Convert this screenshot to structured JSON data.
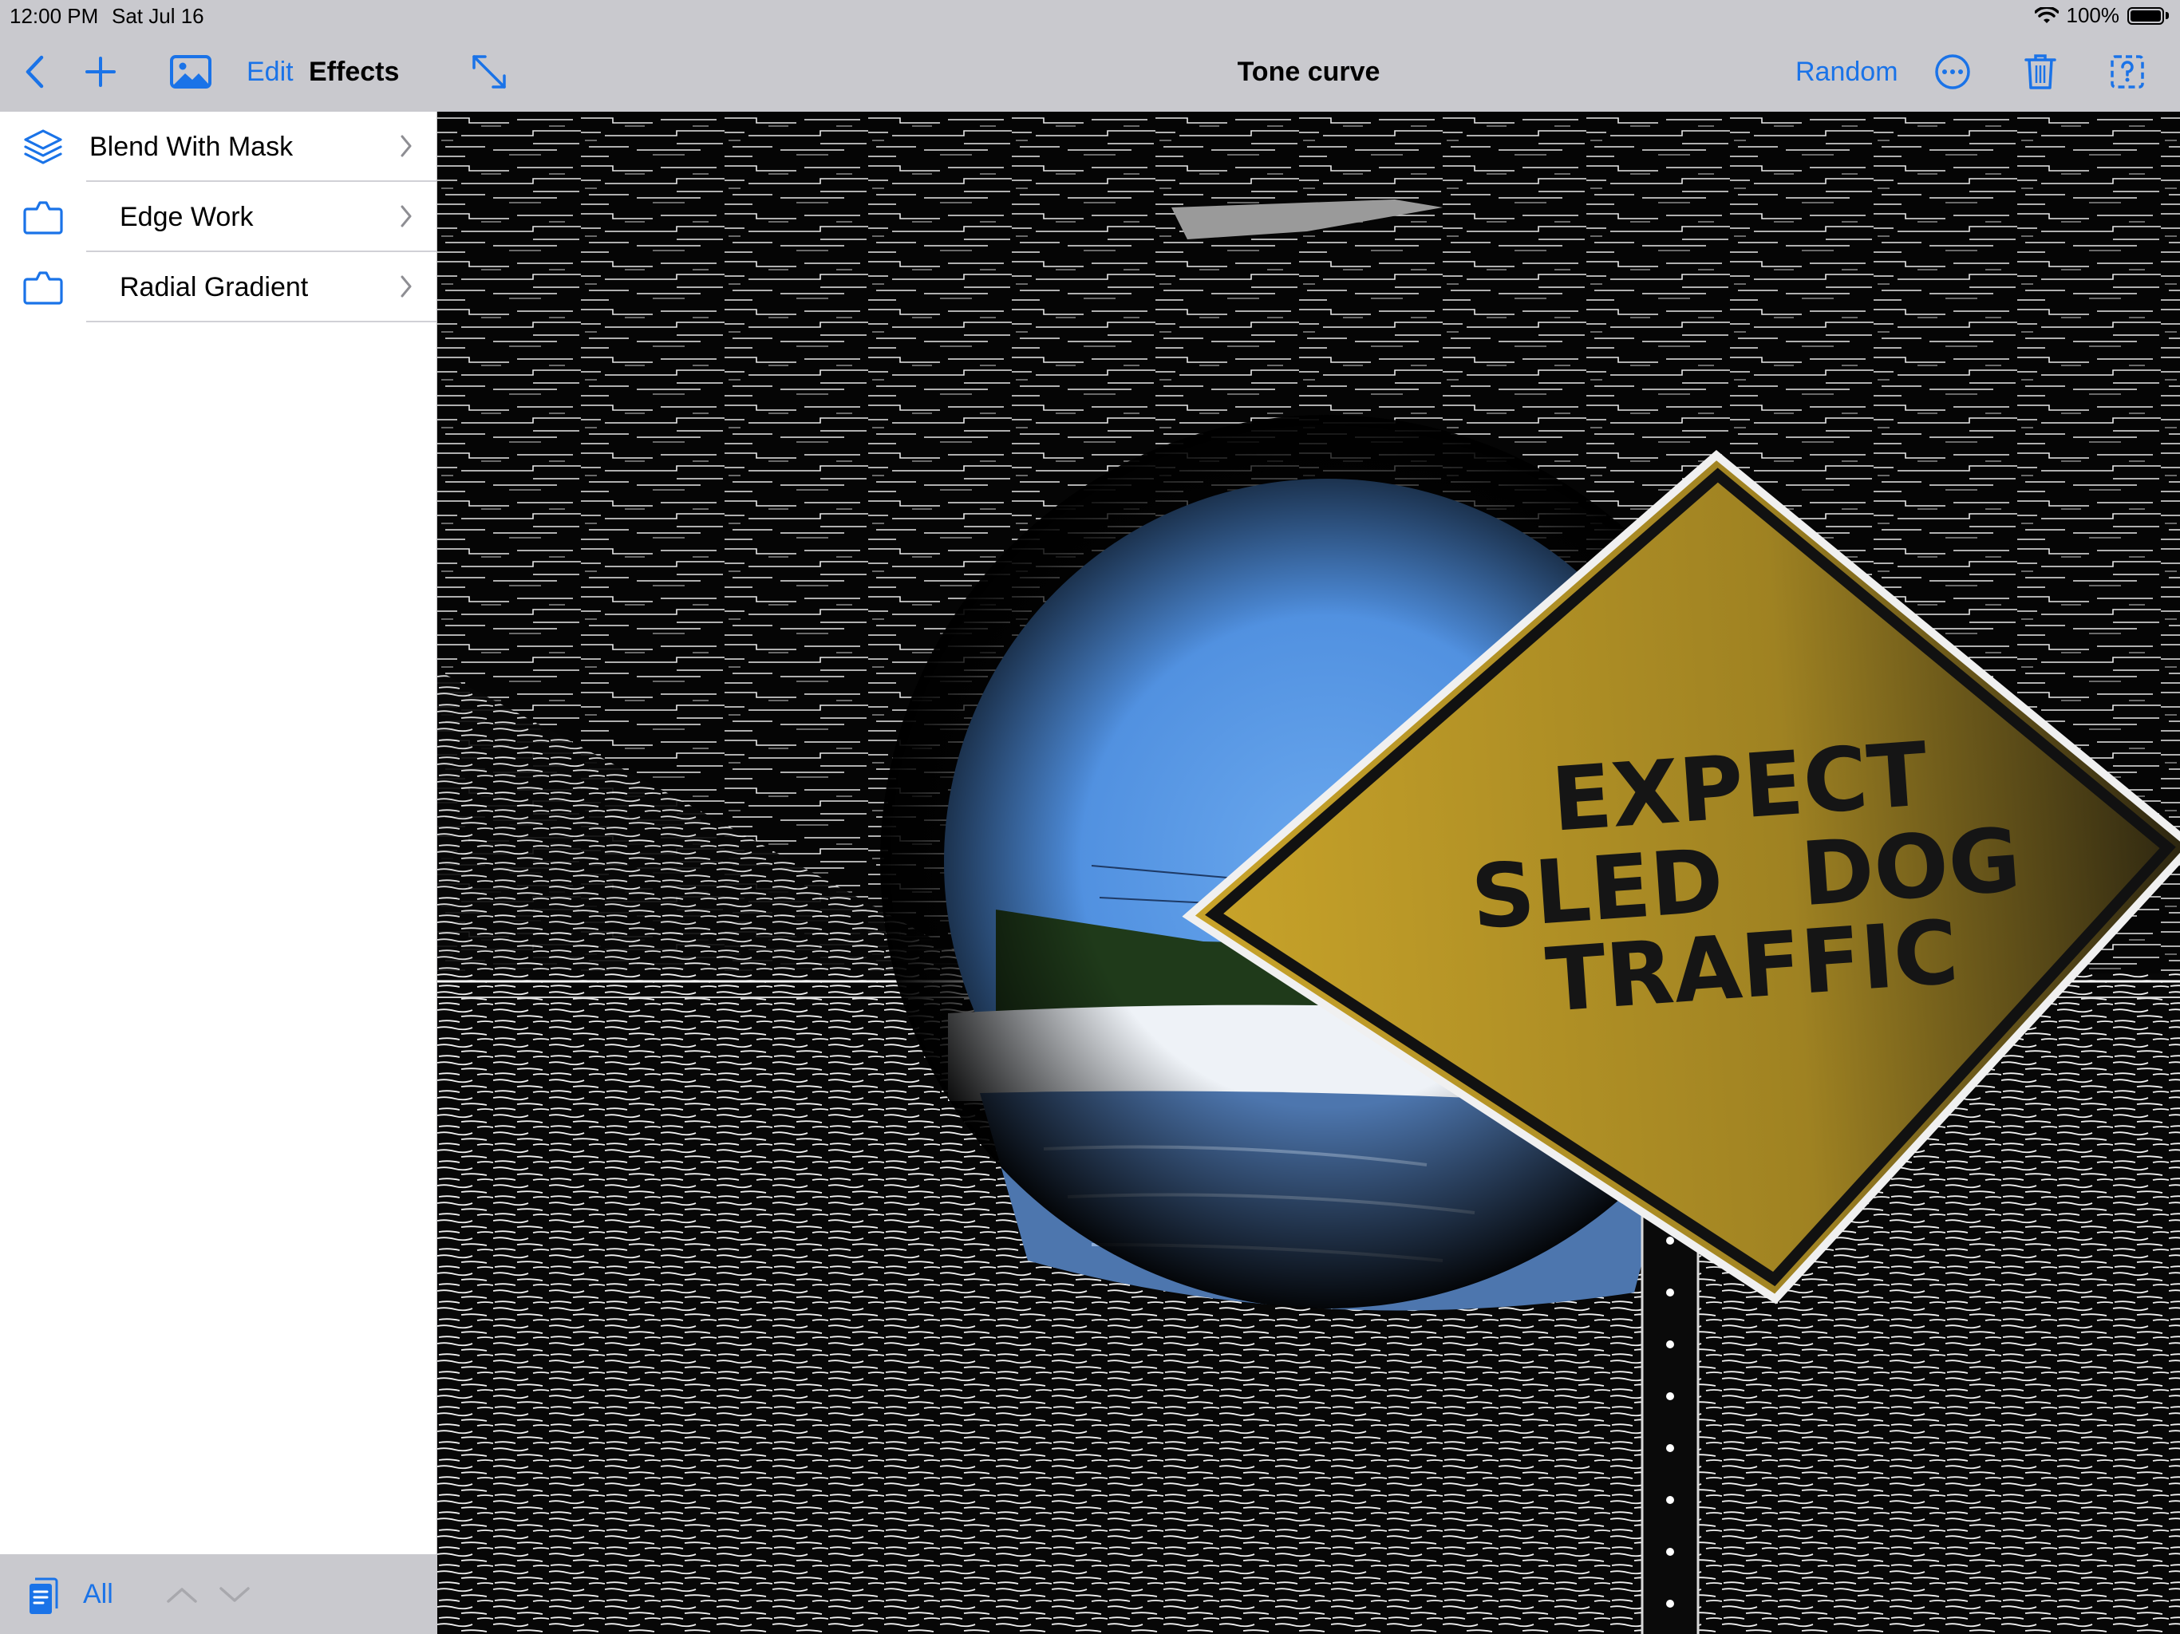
{
  "status": {
    "time": "12:00 PM",
    "date": "Sat Jul 16",
    "battery": "100%",
    "icons": [
      "wifi-icon",
      "battery-icon"
    ]
  },
  "toolbar": {
    "edit_label": "Edit",
    "effects_label": "Effects",
    "title": "Tone curve",
    "random_label": "Random",
    "icons": [
      "back-chevron-icon",
      "plus-icon",
      "photo-icon",
      "expand-arrows-icon",
      "ellipsis-circle-icon",
      "trash-icon",
      "help-square-icon"
    ],
    "accent": "#1a73e8"
  },
  "sidebar": {
    "items": [
      {
        "label": "Blend With Mask",
        "icon": "layers-icon"
      },
      {
        "label": "Edge Work",
        "icon": "tray-icon"
      },
      {
        "label": "Radial Gradient",
        "icon": "tray-icon"
      }
    ]
  },
  "bottom_bar": {
    "all_label": "All",
    "icons": [
      "document-icon",
      "chevron-up-icon",
      "chevron-down-icon"
    ]
  },
  "canvas": {
    "sign_text": [
      "EXPECT",
      "SLED DOG",
      "TRAFFIC"
    ],
    "sign_color": "#b8961e",
    "sky_color": "#5a9ae6"
  }
}
